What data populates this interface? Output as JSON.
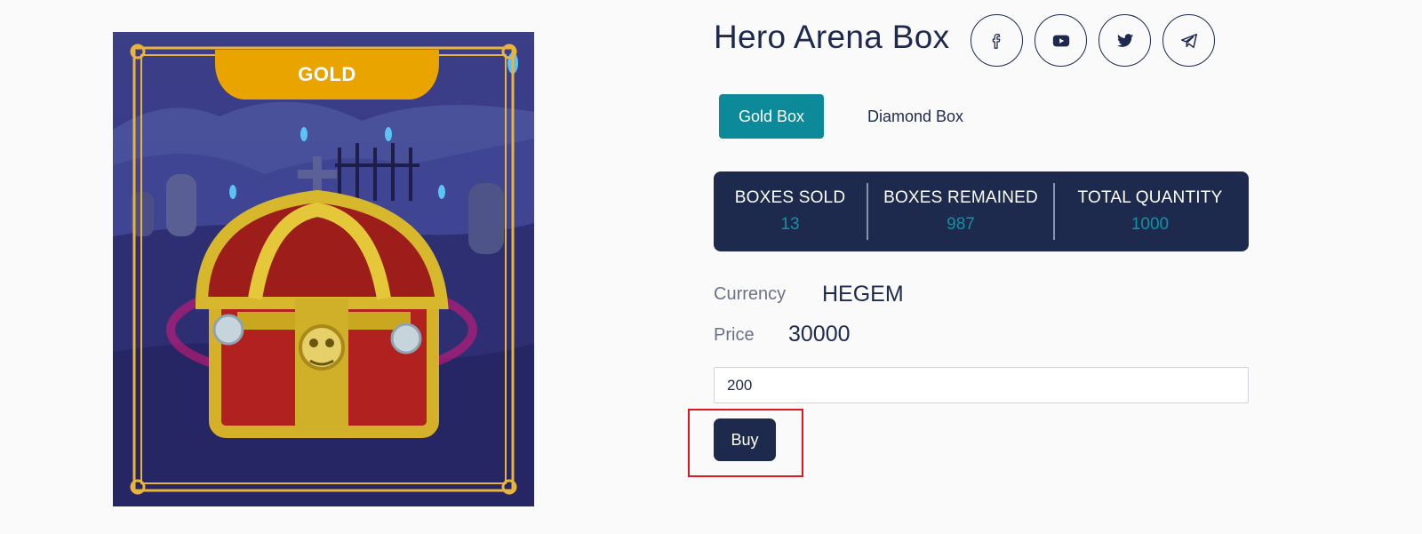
{
  "card": {
    "badge": "GOLD",
    "image": "gold-treasure-chest"
  },
  "header": {
    "title": "Hero Arena Box",
    "social": [
      {
        "icon": "facebook-icon"
      },
      {
        "icon": "youtube-icon"
      },
      {
        "icon": "twitter-icon"
      },
      {
        "icon": "telegram-icon"
      }
    ]
  },
  "tabs": [
    {
      "label": "Gold Box",
      "active": true
    },
    {
      "label": "Diamond Box",
      "active": false
    }
  ],
  "stats": [
    {
      "label": "BOXES SOLD",
      "value": "13"
    },
    {
      "label": "BOXES REMAINED",
      "value": "987"
    },
    {
      "label": "TOTAL QUANTITY",
      "value": "1000"
    }
  ],
  "details": {
    "currency_label": "Currency",
    "currency_value": "HEGEM",
    "price_label": "Price",
    "price_value": "30000"
  },
  "purchase": {
    "quantity_value": "200",
    "buy_label": "Buy"
  },
  "colors": {
    "navy": "#1d2a4d",
    "teal": "#0c8a99",
    "gold": "#e9a400",
    "highlight": "#e0181f"
  }
}
